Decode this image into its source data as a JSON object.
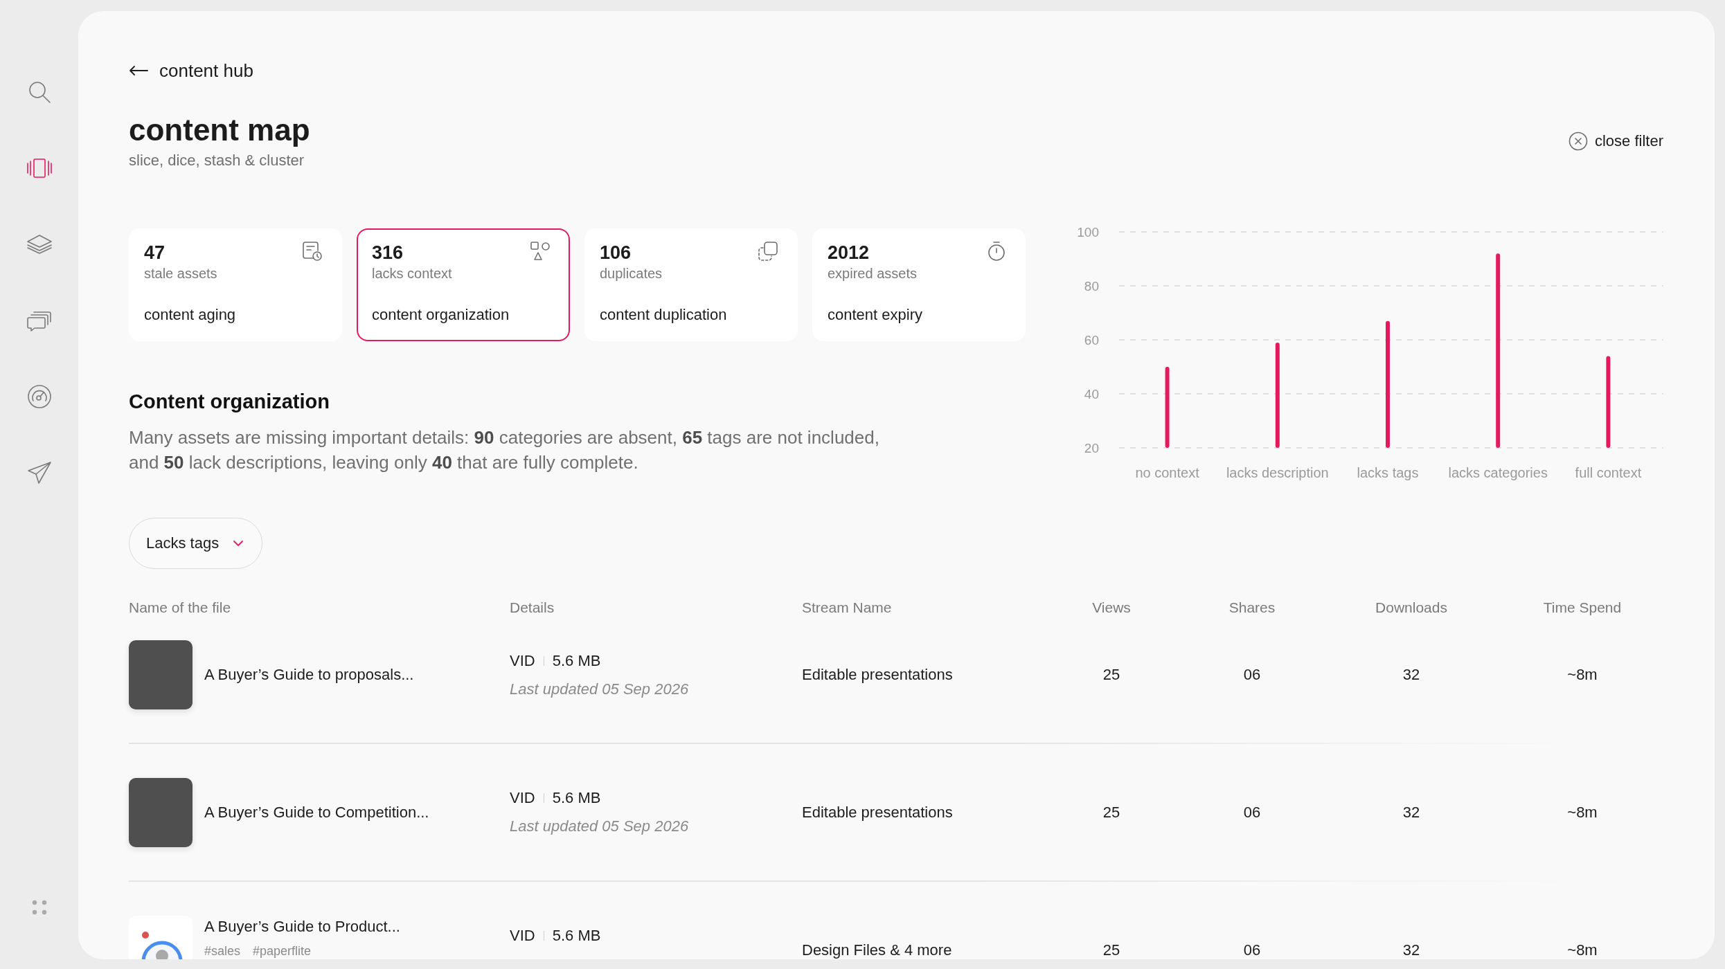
{
  "sidebar": {
    "items": [
      {
        "selected": false
      },
      {
        "selected": true
      },
      {
        "selected": false
      },
      {
        "selected": false
      },
      {
        "selected": false
      },
      {
        "selected": false
      }
    ]
  },
  "header": {
    "back_link": "content hub",
    "title": "content map",
    "subtitle": "slice, dice, stash & cluster",
    "close_button": "close filter"
  },
  "cards": [
    {
      "count": "47",
      "label": "stale assets",
      "title": "content aging",
      "selected": false
    },
    {
      "count": "316",
      "label": "lacks context",
      "title": "content organization",
      "selected": true
    },
    {
      "count": "106",
      "label": "duplicates",
      "title": "content duplication",
      "selected": false
    },
    {
      "count": "2012",
      "label": "expired assets",
      "title": "content expiry",
      "selected": false
    }
  ],
  "chart": {
    "chart_data": {
      "type": "bar",
      "categories": [
        "no context",
        "lacks description",
        "lacks tags",
        "lacks categories",
        "full context"
      ],
      "values": [
        50,
        59,
        67,
        92,
        54
      ],
      "ylim": [
        20,
        100
      ],
      "yticks": [
        20,
        40,
        60,
        80,
        100
      ],
      "grid": true
    }
  },
  "section": {
    "heading": "Content organization",
    "text": "Many assets are missing important details: **90** categories are absent, **65** tags are not included, and **50** lack descriptions, leaving only **40** that are fully complete."
  },
  "filter": {
    "value": "Lacks tags"
  },
  "table": {
    "columns": [
      "Name of the file",
      "Details",
      "Stream Name",
      "Views",
      "Shares",
      "Downloads",
      "Time Spend"
    ],
    "rows": [
      {
        "thumbnail": {
          "kind": "photo"
        },
        "name": "A Buyer’s Guide to proposals...",
        "type": "VID",
        "size": "5.6 MB",
        "updated": "Last updated 05 Sep 2026",
        "stream": "Editable presentations",
        "views": "25",
        "shares": "06",
        "downloads": "32",
        "time": "~8m"
      },
      {
        "thumbnail": {
          "kind": "photo"
        },
        "name": "A Buyer’s Guide to Competition...",
        "type": "VID",
        "size": "5.6 MB",
        "updated": "Last updated 05 Sep 2026",
        "stream": "Editable presentations",
        "views": "25",
        "shares": "06",
        "downloads": "32",
        "time": "~8m"
      },
      {
        "thumbnail": {
          "kind": "illustration"
        },
        "name": "A Buyer’s Guide to Product...",
        "tags": [
          "#sales",
          "#paperflite"
        ],
        "type": "VID",
        "size": "5.6 MB",
        "stream": "Design Files & 4 more",
        "views": "25",
        "shares": "06",
        "downloads": "32",
        "time": "~8m"
      }
    ]
  }
}
